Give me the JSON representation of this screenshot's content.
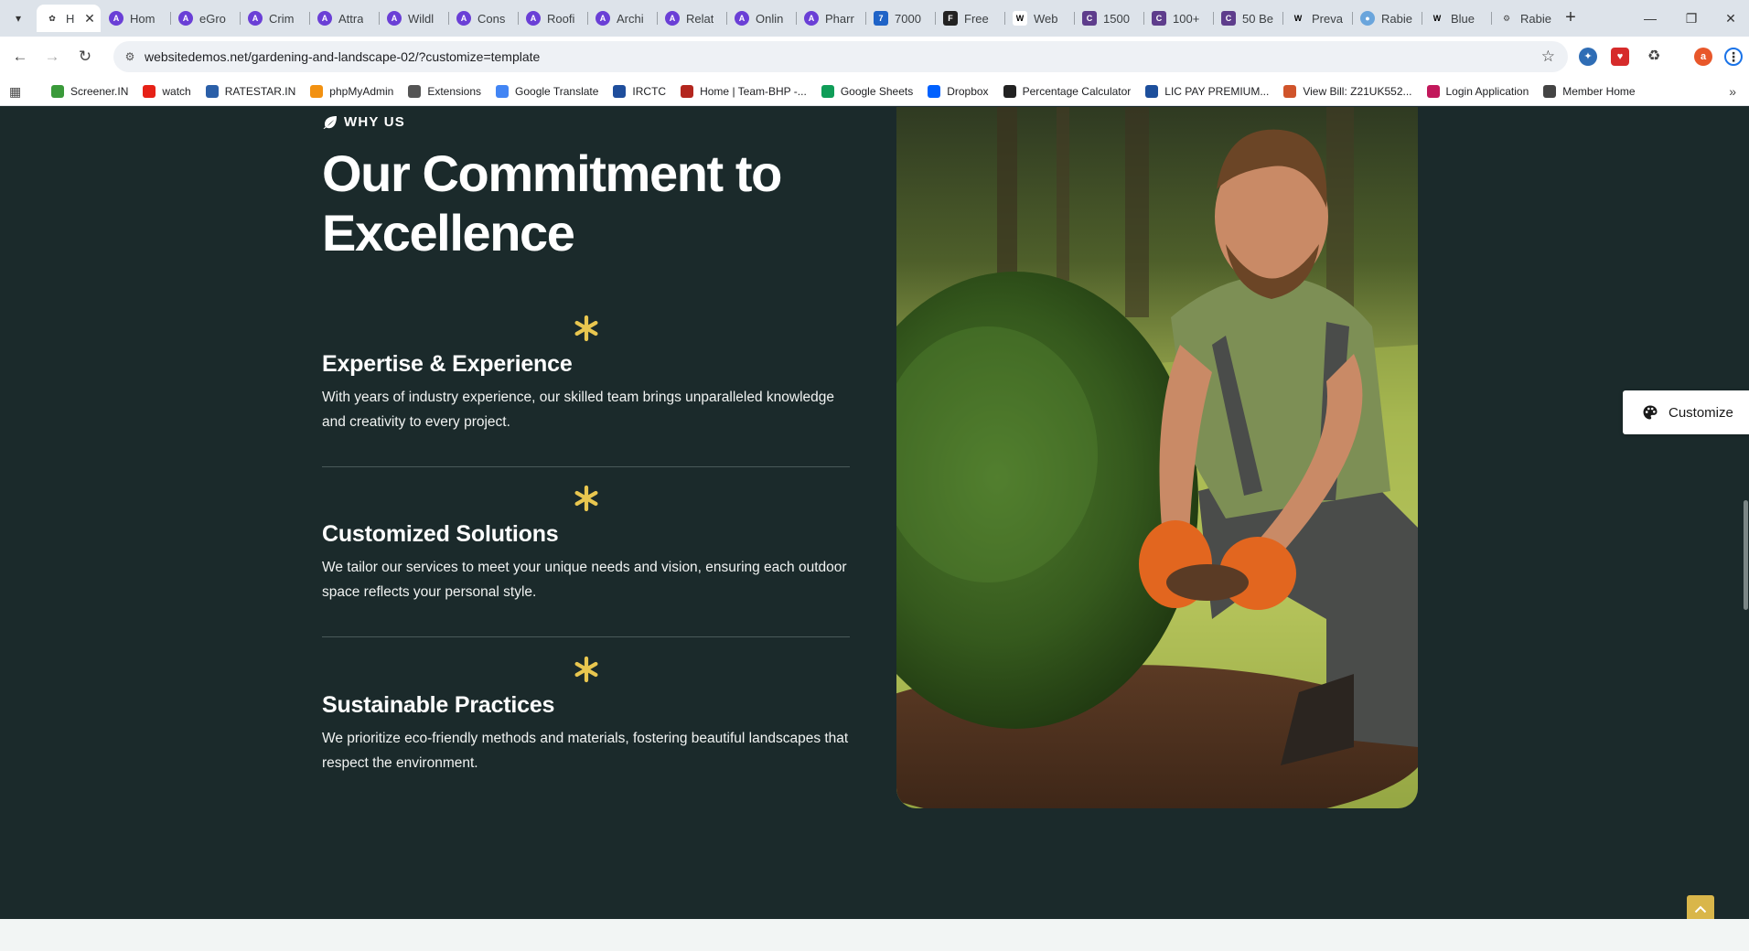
{
  "browser": {
    "tabs": [
      {
        "title": "H",
        "icon": "leaf",
        "active": true
      },
      {
        "title": "Hom",
        "icon": "astra"
      },
      {
        "title": "eGro",
        "icon": "astra"
      },
      {
        "title": "Crim",
        "icon": "astra"
      },
      {
        "title": "Attra",
        "icon": "astra"
      },
      {
        "title": "Wildl",
        "icon": "astra"
      },
      {
        "title": "Cons",
        "icon": "astra"
      },
      {
        "title": "Roofi",
        "icon": "astra"
      },
      {
        "title": "Archi",
        "icon": "astra"
      },
      {
        "title": "Relat",
        "icon": "astra"
      },
      {
        "title": "Onlin",
        "icon": "astra"
      },
      {
        "title": "Pharr",
        "icon": "astra"
      },
      {
        "title": "7000",
        "icon": "blue-square"
      },
      {
        "title": "Free",
        "icon": "black-f"
      },
      {
        "title": "Web",
        "icon": "wix"
      },
      {
        "title": "1500",
        "icon": "purple-square"
      },
      {
        "title": "100+",
        "icon": "purple-square"
      },
      {
        "title": "50 Be",
        "icon": "purple-square"
      },
      {
        "title": "Preva",
        "icon": "wikipedia"
      },
      {
        "title": "Rabie",
        "icon": "globe-blue"
      },
      {
        "title": "Blue",
        "icon": "wikipedia"
      },
      {
        "title": "Rabie",
        "icon": "globe-gear"
      }
    ],
    "url": "websitedemos.net/gardening-and-landscape-02/?customize=template",
    "profile_initial": "a",
    "bookmarks": [
      {
        "label": "Screener.IN",
        "color": "#3a9a3a"
      },
      {
        "label": "watch",
        "color": "#e62117"
      },
      {
        "label": "RATESTAR.IN",
        "color": "#2b5fa8"
      },
      {
        "label": "phpMyAdmin",
        "color": "#f29111"
      },
      {
        "label": "Extensions",
        "color": "#555555"
      },
      {
        "label": "Google Translate",
        "color": "#4285f4"
      },
      {
        "label": "IRCTC",
        "color": "#1f4e9c"
      },
      {
        "label": "Home | Team-BHP -...",
        "color": "#b3261e"
      },
      {
        "label": "Google Sheets",
        "color": "#0f9d58"
      },
      {
        "label": "Dropbox",
        "color": "#0061fe"
      },
      {
        "label": "Percentage Calculator",
        "color": "#222222"
      },
      {
        "label": "LIC PAY PREMIUM...",
        "color": "#1d4f9c"
      },
      {
        "label": "View Bill: Z21UK552...",
        "color": "#d0542b"
      },
      {
        "label": "Login Application",
        "color": "#c2185b"
      },
      {
        "label": "Member Home",
        "color": "#444444"
      }
    ]
  },
  "section": {
    "eyebrow": "WHY US",
    "heading": "Our Commitment to Excellence",
    "features": [
      {
        "title": "Expertise & Experience",
        "description": "With years of industry experience, our skilled team brings unparalleled knowledge and creativity to every project."
      },
      {
        "title": "Customized Solutions",
        "description": "We tailor our services to meet your unique needs and vision, ensuring each outdoor space reflects your personal style."
      },
      {
        "title": "Sustainable Practices",
        "description": "We prioritize eco-friendly methods and materials, fostering beautiful landscapes that respect the environment."
      }
    ],
    "accent_color": "#e8c64f",
    "background_color": "#1b2a2b"
  },
  "customize_button": {
    "label": "Customize"
  }
}
